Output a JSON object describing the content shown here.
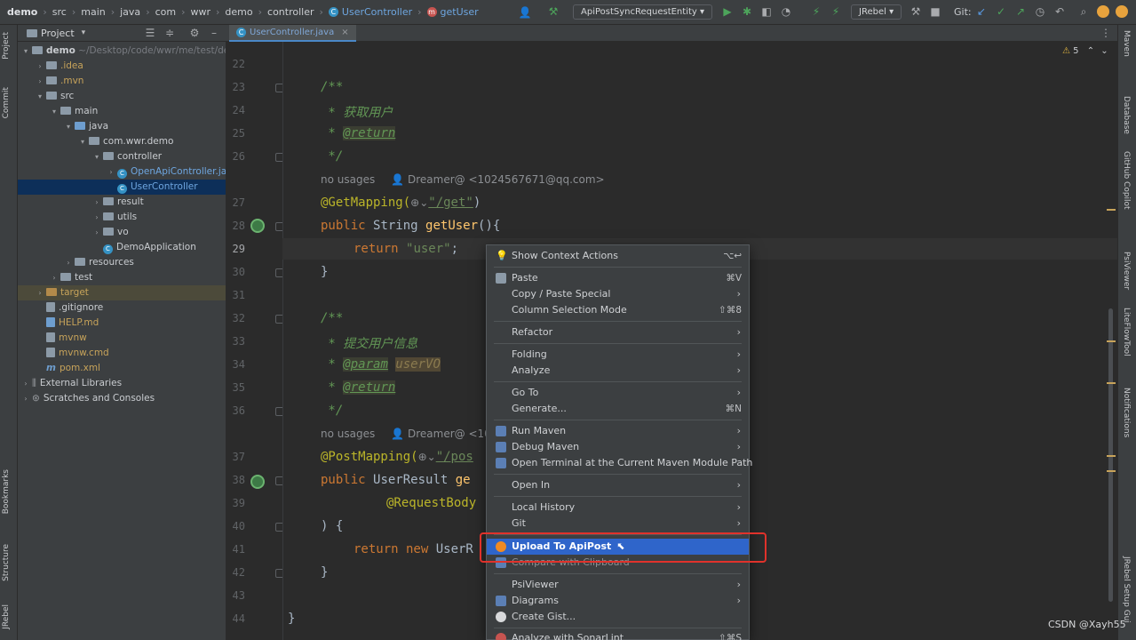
{
  "breadcrumb": [
    "demo",
    "src",
    "main",
    "java",
    "com",
    "wwr",
    "demo",
    "controller",
    "UserController",
    "getUser"
  ],
  "toolbar": {
    "run_config": "ApiPostSyncRequestEntity",
    "jrebel": "JRebel",
    "git_label": "Git:"
  },
  "left_stripe": {
    "project": "Project",
    "commit": "Commit",
    "bookmarks": "Bookmarks",
    "structure": "Structure",
    "jrebel": "JRebel"
  },
  "project_panel": {
    "title": "Project",
    "tree": [
      {
        "label": "demo",
        "hint": "~/Desktop/code/wwr/me/test/de"
      },
      {
        "label": ".idea"
      },
      {
        "label": ".mvn"
      },
      {
        "label": "src"
      },
      {
        "label": "main"
      },
      {
        "label": "java"
      },
      {
        "label": "com.wwr.demo"
      },
      {
        "label": "controller"
      },
      {
        "label": "OpenApiController.ja"
      },
      {
        "label": "UserController"
      },
      {
        "label": "result"
      },
      {
        "label": "utils"
      },
      {
        "label": "vo"
      },
      {
        "label": "DemoApplication"
      },
      {
        "label": "resources"
      },
      {
        "label": "test"
      },
      {
        "label": "target"
      },
      {
        "label": ".gitignore"
      },
      {
        "label": "HELP.md"
      },
      {
        "label": "mvnw"
      },
      {
        "label": "mvnw.cmd"
      },
      {
        "label": "pom.xml"
      },
      {
        "label": "External Libraries"
      },
      {
        "label": "Scratches and Consoles"
      }
    ]
  },
  "editor": {
    "tab": "UserController.java",
    "warnings": "5",
    "line_numbers": [
      "22",
      "23",
      "24",
      "25",
      "26",
      "",
      "27",
      "28",
      "29",
      "30",
      "31",
      "32",
      "33",
      "34",
      "35",
      "36",
      "",
      "37",
      "38",
      "39",
      "40",
      "41",
      "42",
      "43",
      "44"
    ],
    "code": {
      "l23": "/**",
      "l24_star": " * ",
      "l24_text": "获取用户",
      "l25_star": " * ",
      "l25_tag": "@return",
      "l26": " */",
      "usage1": "no usages",
      "author1": "Dreamer@ <1024567671@qq.com>",
      "l27_ann": "@GetMapping(",
      "l27_path": "\"/get\"",
      "l27_end": ")",
      "l28_kw": "public ",
      "l28_type": "String ",
      "l28_fn": "getUser",
      "l28_end": "(){",
      "l29_kw": "return ",
      "l29_str": "\"user\"",
      "l29_end": ";",
      "l30": "}",
      "l32": "/**",
      "l33_star": " * ",
      "l33_text": "提交用户信息",
      "l34_star": " * ",
      "l34_tag": "@param",
      "l34_param": "userVO",
      "l35_star": " * ",
      "l35_tag": "@return",
      "l36": " */",
      "usage2": "no usages",
      "author2": "Dreamer@ <10",
      "l37_ann": "@PostMapping(",
      "l37_path": "\"/pos",
      "l38_kw": "public ",
      "l38_type": "UserResult ",
      "l38_fn": "ge",
      "l39_ann": "@RequestBody",
      "l40": ") {",
      "l41_kw": "return new ",
      "l41_type": "UserR",
      "l42": "}",
      "l44": "}"
    }
  },
  "right_stripe": {
    "maven": "Maven",
    "database": "Database",
    "copilot": "GitHub Copilot",
    "psiviewer": "PsiViewer",
    "liteflow": "LiteFlowTool",
    "notifications": "Notifications",
    "jrebel_setup": "JRebel Setup Gui"
  },
  "context_menu": [
    {
      "label": "Show Context Actions",
      "shortcut": "⌥↩"
    },
    {
      "label": "Paste",
      "shortcut": "⌘V"
    },
    {
      "label": "Copy / Paste Special",
      "submenu": "›"
    },
    {
      "label": "Column Selection Mode",
      "shortcut": "⇧⌘8"
    },
    {
      "label": "Refactor",
      "submenu": "›"
    },
    {
      "label": "Folding",
      "submenu": "›"
    },
    {
      "label": "Analyze",
      "submenu": "›"
    },
    {
      "label": "Go To",
      "submenu": "›"
    },
    {
      "label": "Generate...",
      "shortcut": "⌘N"
    },
    {
      "label": "Run Maven",
      "submenu": "›"
    },
    {
      "label": "Debug Maven",
      "submenu": "›"
    },
    {
      "label": "Open Terminal at the Current Maven Module Path"
    },
    {
      "label": "Open In",
      "submenu": "›"
    },
    {
      "label": "Local History",
      "submenu": "›"
    },
    {
      "label": "Git",
      "submenu": "›"
    },
    {
      "label": "Upload To ApiPost"
    },
    {
      "label": "Compare with Clipboard"
    },
    {
      "label": "PsiViewer",
      "submenu": "›"
    },
    {
      "label": "Diagrams",
      "submenu": "›"
    },
    {
      "label": "Create Gist..."
    },
    {
      "label": "Analyze with SonarLint",
      "shortcut": "⇧⌘S"
    }
  ],
  "watermark": "CSDN @Xayh55",
  "colors": {
    "menu_highlight": "#2f65ca",
    "red_box": "#e0322b",
    "selection": "#0d2f59"
  }
}
